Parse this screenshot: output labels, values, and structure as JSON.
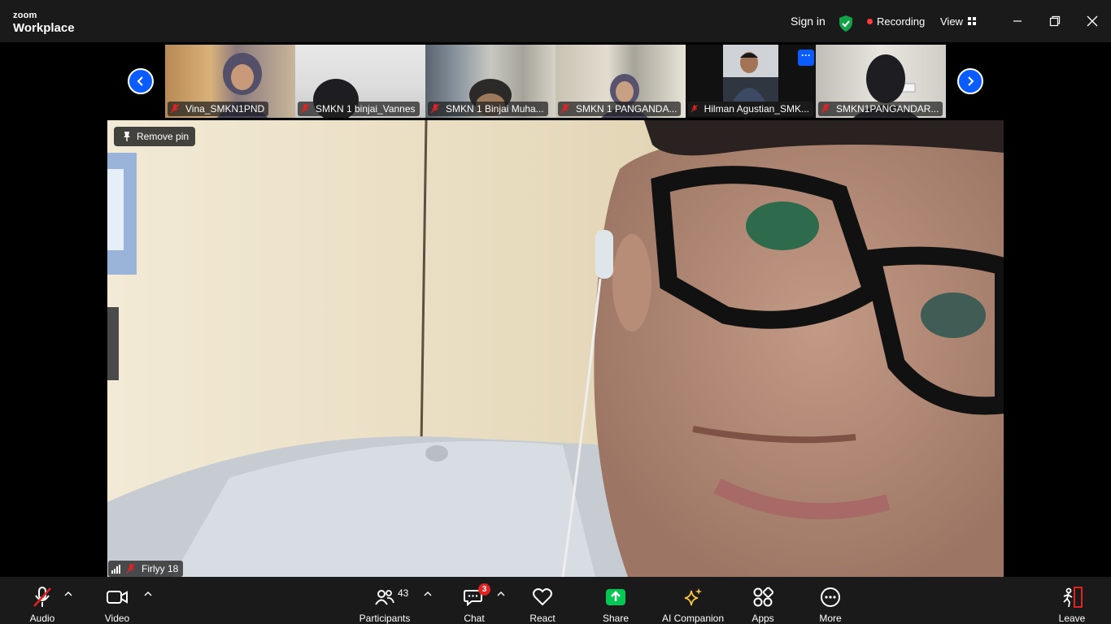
{
  "app": {
    "logo_line1": "zoom",
    "logo_line2": "Workplace"
  },
  "titlebar": {
    "sign_in": "Sign in",
    "recording": "Recording",
    "view": "View",
    "colors": {
      "shield": "#15a34a",
      "record_dot": "#ff3b3b"
    }
  },
  "gallery": {
    "thumbnails": [
      {
        "name": "Vina_SMKN1PND",
        "muted": true
      },
      {
        "name": "SMKN 1 binjai_Vannes",
        "muted": true
      },
      {
        "name": "SMKN 1 Binjai Muha...",
        "muted": true
      },
      {
        "name": "SMKN 1 PANGANDA...",
        "muted": true
      },
      {
        "name": "Hilman Agustian_SMK...",
        "muted": true
      },
      {
        "name": "SMKN1PANGANDAR...",
        "muted": true
      }
    ],
    "more_label": "···",
    "accent": "#0b5cff"
  },
  "main_video": {
    "remove_pin_label": "Remove pin",
    "participant_name": "Firlyy 18"
  },
  "toolbar": {
    "audio": "Audio",
    "video": "Video",
    "participants": "Participants",
    "participants_count": "43",
    "chat": "Chat",
    "chat_badge": "3",
    "react": "React",
    "share": "Share",
    "ai_companion": "AI Companion",
    "apps": "Apps",
    "more": "More",
    "leave": "Leave",
    "colors": {
      "share": "#00c853",
      "ai": "#f5c542",
      "mute": "#e02424"
    }
  }
}
